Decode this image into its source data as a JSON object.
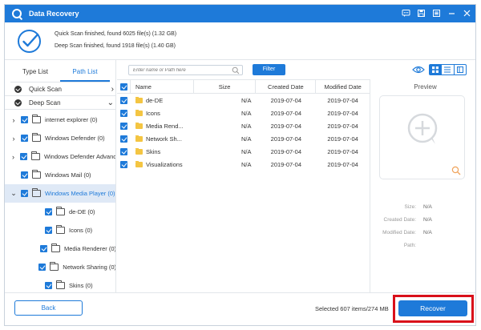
{
  "window": {
    "title": "Data Recovery"
  },
  "status": {
    "quick_scan": "Quick Scan finished, found 6025 file(s) (1.32 GB)",
    "deep_scan": "Deep Scan finished, found 1918 file(s) (1.40 GB)"
  },
  "tabs": [
    "Type List",
    "Path List"
  ],
  "active_tab": "Path List",
  "modes": {
    "quick": "Quick Scan",
    "deep": "Deep Scan"
  },
  "tree": [
    {
      "label": "internet explorer (0)",
      "level": 0,
      "expander": "›",
      "selected": false
    },
    {
      "label": "Windows Defender (0)",
      "level": 0,
      "expander": "›",
      "selected": false
    },
    {
      "label": "Windows Defender Advanc",
      "level": 0,
      "expander": "›",
      "selected": false
    },
    {
      "label": "Windows Mail (0)",
      "level": 0,
      "expander": "",
      "selected": false
    },
    {
      "label": "Windows Media Player (0)",
      "level": 0,
      "expander": "⌄",
      "selected": true
    },
    {
      "label": "de-DE (0)",
      "level": 1,
      "expander": "",
      "selected": false
    },
    {
      "label": "Icons (0)",
      "level": 1,
      "expander": "",
      "selected": false
    },
    {
      "label": "Media Renderer (0)",
      "level": 1,
      "expander": "",
      "selected": false
    },
    {
      "label": "Network Sharing (0)",
      "level": 1,
      "expander": "",
      "selected": false
    },
    {
      "label": "Skins (0)",
      "level": 1,
      "expander": "",
      "selected": false
    }
  ],
  "search": {
    "placeholder": "Enter name or Path here"
  },
  "toolbar": {
    "filter_label": "Filter"
  },
  "table": {
    "columns": {
      "name": "Name",
      "size": "Size",
      "created": "Created Date",
      "modified": "Modified Date"
    },
    "rows": [
      {
        "name": "de-DE",
        "size": "N/A",
        "created": "2019-07-04",
        "modified": "2019-07-04"
      },
      {
        "name": "Icons",
        "size": "N/A",
        "created": "2019-07-04",
        "modified": "2019-07-04"
      },
      {
        "name": "Media Rend...",
        "size": "N/A",
        "created": "2019-07-04",
        "modified": "2019-07-04"
      },
      {
        "name": "Network Sh...",
        "size": "N/A",
        "created": "2019-07-04",
        "modified": "2019-07-04"
      },
      {
        "name": "Skins",
        "size": "N/A",
        "created": "2019-07-04",
        "modified": "2019-07-04"
      },
      {
        "name": "Visualizations",
        "size": "N/A",
        "created": "2019-07-04",
        "modified": "2019-07-04"
      }
    ]
  },
  "preview": {
    "title": "Preview",
    "fields": [
      {
        "key": "Size:",
        "value": "N/A"
      },
      {
        "key": "Created Date:",
        "value": "N/A"
      },
      {
        "key": "Modified Date:",
        "value": "N/A"
      },
      {
        "key": "Path:",
        "value": ""
      }
    ]
  },
  "footer": {
    "back_label": "Back",
    "selected_info": "Selected 607 items/274 MB",
    "recover_label": "Recover"
  },
  "colors": {
    "accent": "#1e7ad9",
    "highlight": "#d9101a",
    "folder": "#f4c542",
    "selected_row": "#dfe9f6"
  },
  "icons": [
    "app-logo-icon",
    "feedback-icon",
    "save-icon",
    "menu-icon",
    "minimize-icon",
    "close-icon",
    "check-circle-icon",
    "search-icon",
    "eye-icon",
    "grid-view-icon",
    "list-view-icon",
    "detail-view-icon",
    "zoom-icon",
    "folder-icon"
  ]
}
